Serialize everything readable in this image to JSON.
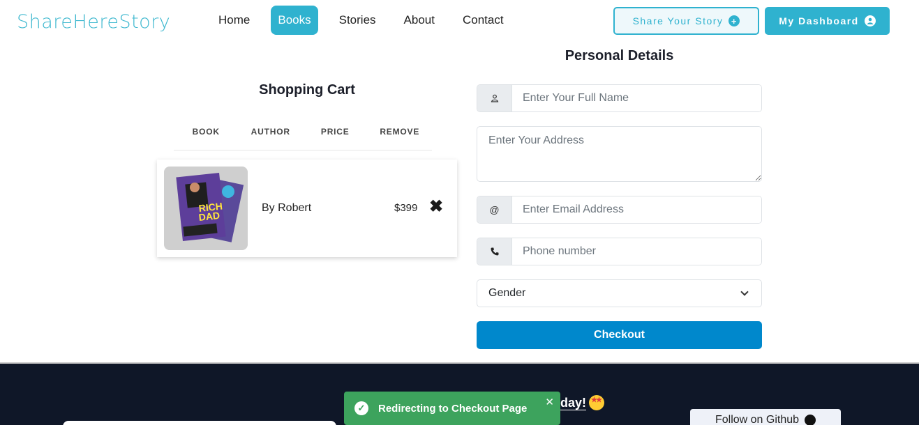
{
  "navbar": {
    "brand": "ShareHereStory",
    "links": [
      {
        "label": "Home",
        "active": false
      },
      {
        "label": "Books",
        "active": true
      },
      {
        "label": "Stories",
        "active": false
      },
      {
        "label": "About",
        "active": false
      },
      {
        "label": "Contact",
        "active": false
      }
    ],
    "share_button": "Share Your Story",
    "dashboard_button": "My Dashboard"
  },
  "cart": {
    "title": "Shopping Cart",
    "columns": [
      "BOOK",
      "AUTHOR",
      "PRICE",
      "REMOVE"
    ],
    "items": [
      {
        "book_cover_text": "RICH DAD",
        "author": "By Robert",
        "price": "$399",
        "remove_icon": "close-icon"
      }
    ]
  },
  "form": {
    "title": "Personal Details",
    "name_placeholder": "Enter Your Full Name",
    "address_placeholder": "Enter Your Address",
    "email_placeholder": "Enter Email Address",
    "email_addon": "@",
    "phone_placeholder": "Phone number",
    "gender_selected": "Gender",
    "checkout_label": "Checkout"
  },
  "footer": {
    "heading": "day!",
    "github_button": "Follow on Github"
  },
  "toast": {
    "message": "Redirecting to Checkout Page"
  },
  "colors": {
    "accent": "#2fb2cf",
    "checkout": "#0088cc",
    "footer_bg": "#0f1728",
    "toast_bg": "#3da35d"
  }
}
